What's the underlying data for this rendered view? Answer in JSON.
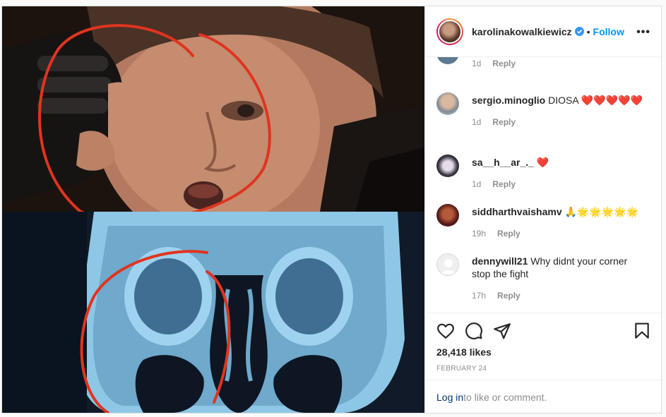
{
  "post": {
    "username": "karolinakowalkiewicz",
    "separator": "•",
    "follow_label": "Follow",
    "more_label": "•••",
    "verified_icon": "verified-badge-icon",
    "verified_color": "#3897f0"
  },
  "comments": [
    {
      "user": "",
      "text": "",
      "time": "1d",
      "reply": "Reply"
    },
    {
      "user": "sergio.minoglio",
      "text": "DIOSA ❤️❤️❤️❤️❤️",
      "time": "1d",
      "reply": "Reply"
    },
    {
      "user": "sa__h__ar_._",
      "text": "❤️",
      "time": "1d",
      "reply": "Reply"
    },
    {
      "user": "siddharthvaishamv",
      "text": "🙏🌟🌟🌟🌟🌟",
      "time": "19h",
      "reply": "Reply"
    },
    {
      "user": "dennywill21",
      "text": "Why didnt your corner stop the fight",
      "time": "17h",
      "reply": "Reply"
    }
  ],
  "actions": {
    "like_icon": "heart-icon",
    "comment_icon": "comment-icon",
    "share_icon": "share-icon",
    "save_icon": "bookmark-icon",
    "likes": "28,418 likes",
    "date": "FEBRUARY 24"
  },
  "login": {
    "link": "Log in",
    "rest": " to like or comment."
  },
  "colors": {
    "accent": "#0095f6",
    "annotation_red": "#e0341f",
    "scan_blue": "#8ec7e6"
  }
}
